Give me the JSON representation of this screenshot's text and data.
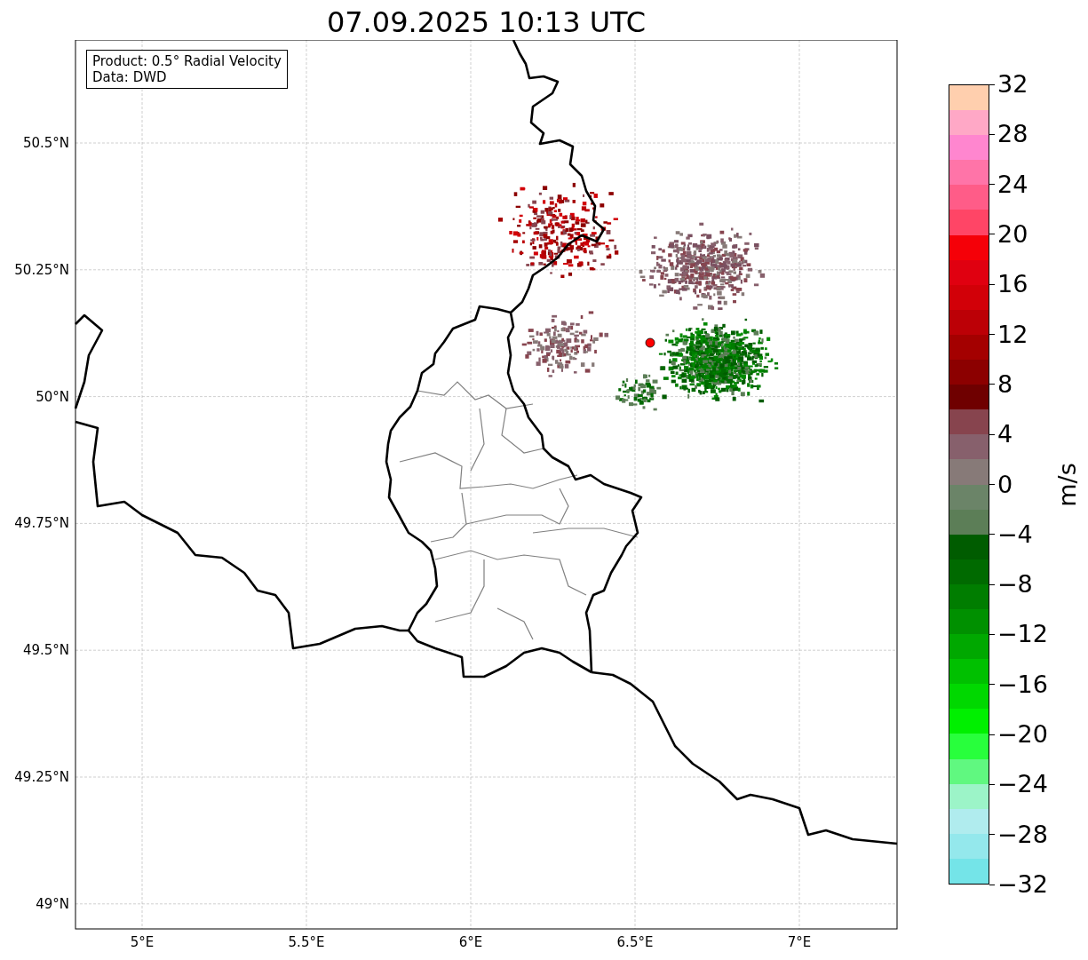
{
  "title": "07.09.2025 10:13 UTC",
  "info_box": [
    "Product: 0.5° Radial Velocity",
    "Data: DWD"
  ],
  "map": {
    "lat_ticks": [
      "50.5°N",
      "50.25°N",
      "50°N",
      "49.75°N",
      "49.5°N",
      "49.25°N",
      "49°N"
    ],
    "lon_ticks": [
      "5°E",
      "5.5°E",
      "6°E",
      "6.5°E",
      "7°E"
    ]
  },
  "colorbar": {
    "label": "m/s",
    "ticks": [
      "32",
      "28",
      "24",
      "20",
      "16",
      "12",
      "8",
      "4",
      "0",
      "−4",
      "−8",
      "−12",
      "−16",
      "−20",
      "−24",
      "−28",
      "−32"
    ],
    "bands": [
      {
        "color": "#ffcfae"
      },
      {
        "color": "#ffa8c6"
      },
      {
        "color": "#ff86cf"
      },
      {
        "color": "#ff74a8"
      },
      {
        "color": "#ff5c88"
      },
      {
        "color": "#ff4566"
      },
      {
        "color": "#f50008"
      },
      {
        "color": "#e00010"
      },
      {
        "color": "#d20008"
      },
      {
        "color": "#bc0006"
      },
      {
        "color": "#a40000"
      },
      {
        "color": "#8c0000"
      },
      {
        "color": "#6f0000"
      },
      {
        "color": "#87444e"
      },
      {
        "color": "#87606c"
      },
      {
        "color": "#877a78"
      },
      {
        "color": "#6b8468"
      },
      {
        "color": "#5c7e57"
      },
      {
        "color": "#005c00"
      },
      {
        "color": "#006a00"
      },
      {
        "color": "#007d00"
      },
      {
        "color": "#009000"
      },
      {
        "color": "#00a800"
      },
      {
        "color": "#00c000"
      },
      {
        "color": "#00d800"
      },
      {
        "color": "#00f000"
      },
      {
        "color": "#28ff3c"
      },
      {
        "color": "#60f880"
      },
      {
        "color": "#9cf4c8"
      },
      {
        "color": "#b0ecee"
      },
      {
        "color": "#94e8ec"
      },
      {
        "color": "#74e4e8"
      }
    ]
  }
}
